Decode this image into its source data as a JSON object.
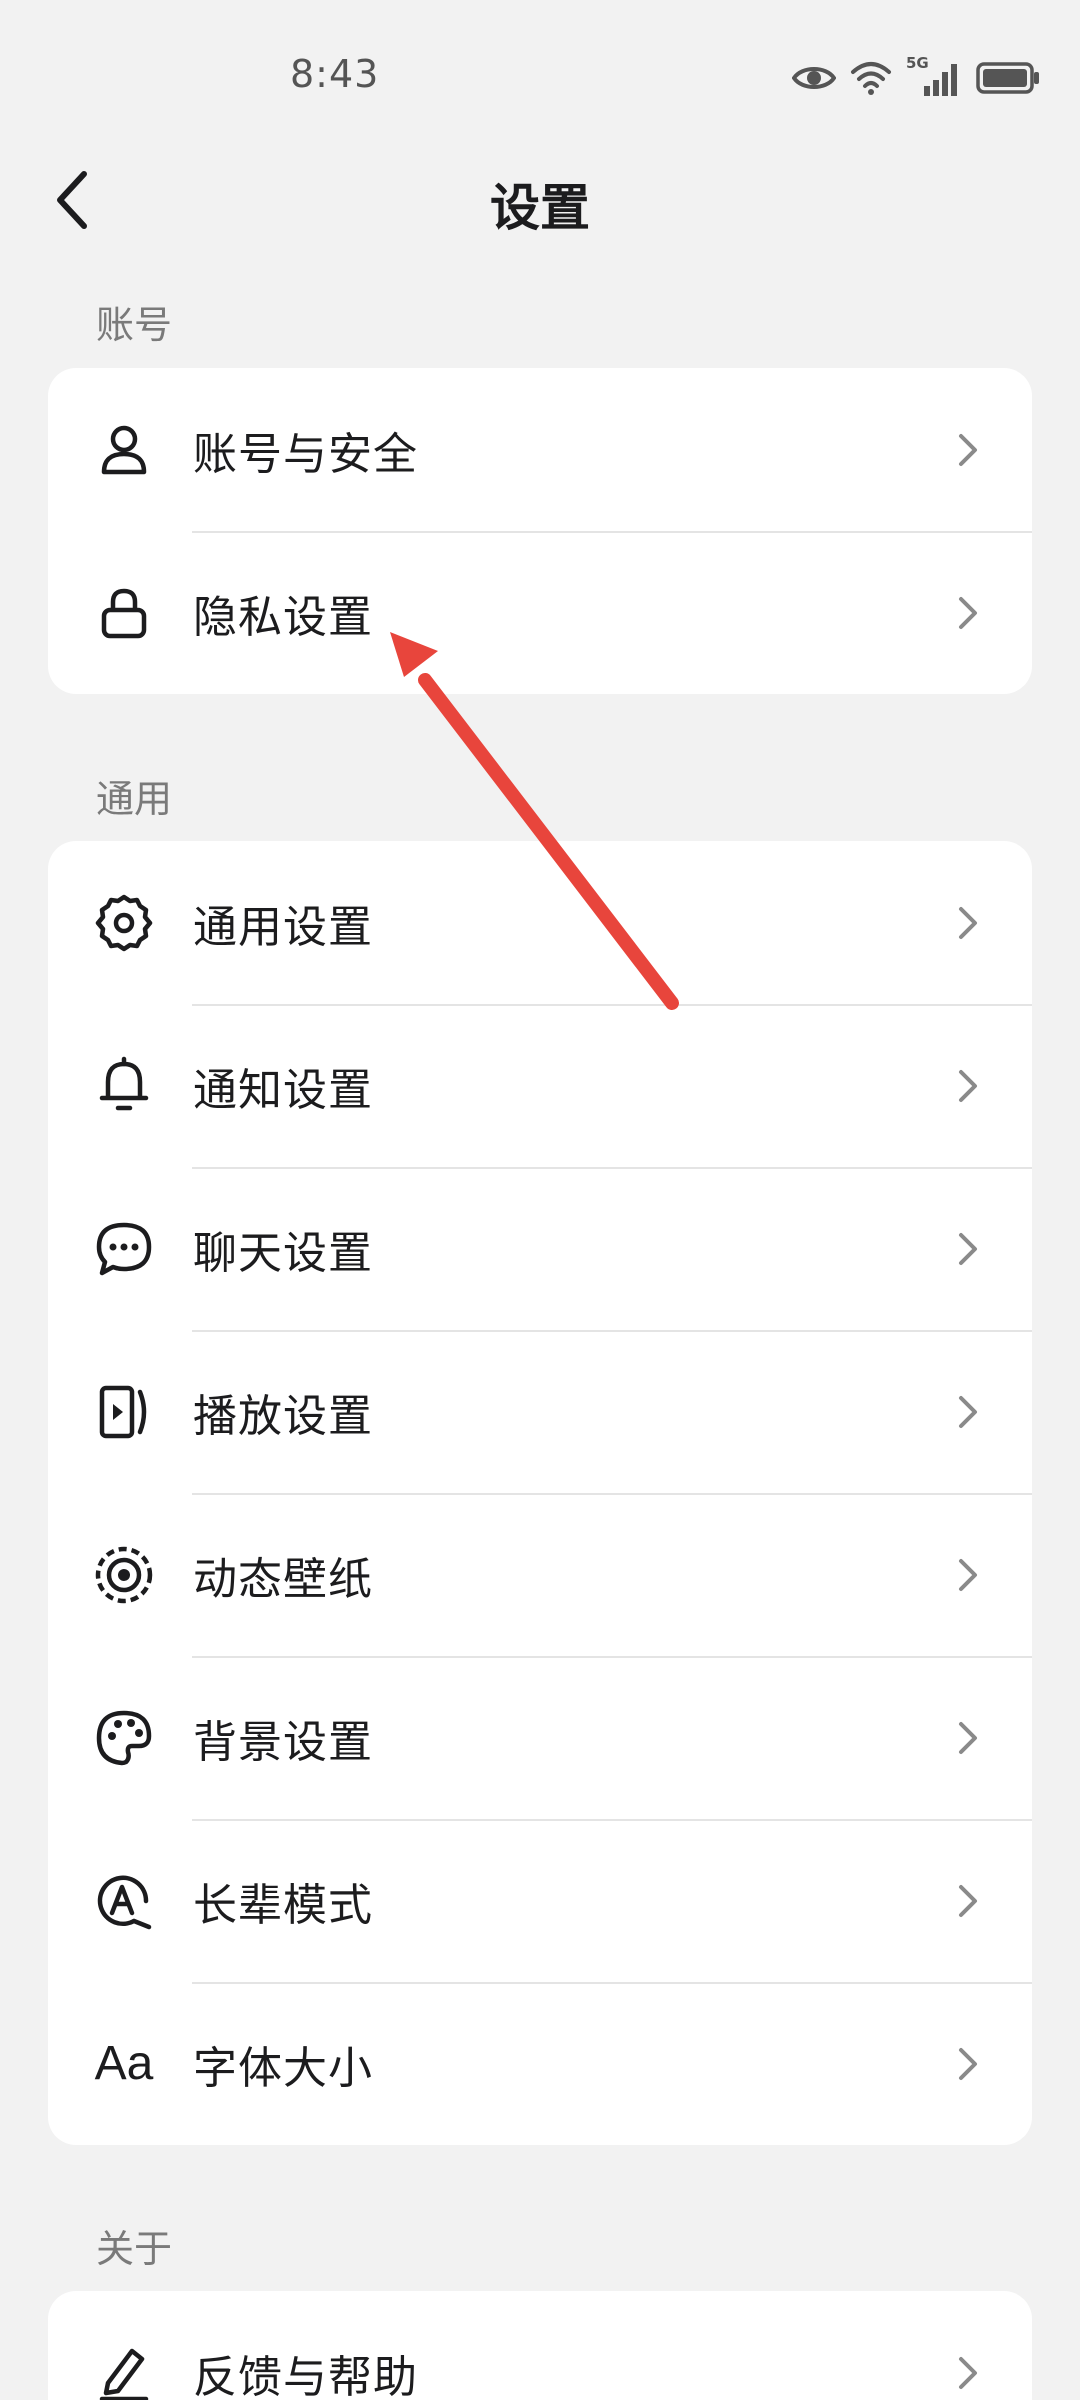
{
  "status_bar": {
    "time": "8:43",
    "network": "5G"
  },
  "header": {
    "title": "设置"
  },
  "sections": [
    {
      "header": "账号",
      "items": [
        {
          "label": "账号与安全",
          "icon": "user-icon"
        },
        {
          "label": "隐私设置",
          "icon": "lock-icon"
        }
      ]
    },
    {
      "header": "通用",
      "items": [
        {
          "label": "通用设置",
          "icon": "gear-icon"
        },
        {
          "label": "通知设置",
          "icon": "bell-icon"
        },
        {
          "label": "聊天设置",
          "icon": "chat-bubble-icon"
        },
        {
          "label": "播放设置",
          "icon": "play-icon"
        },
        {
          "label": "动态壁纸",
          "icon": "live-wallpaper-icon"
        },
        {
          "label": "背景设置",
          "icon": "palette-icon"
        },
        {
          "label": "长辈模式",
          "icon": "elder-mode-icon"
        },
        {
          "label": "字体大小",
          "icon": "font-size-icon",
          "icon_text": "Aa"
        }
      ]
    },
    {
      "header": "关于",
      "items": [
        {
          "label": "反馈与帮助",
          "icon": "edit-pen-icon"
        }
      ]
    }
  ],
  "annotation": {
    "color": "#e8453c",
    "target": "隐私设置"
  }
}
